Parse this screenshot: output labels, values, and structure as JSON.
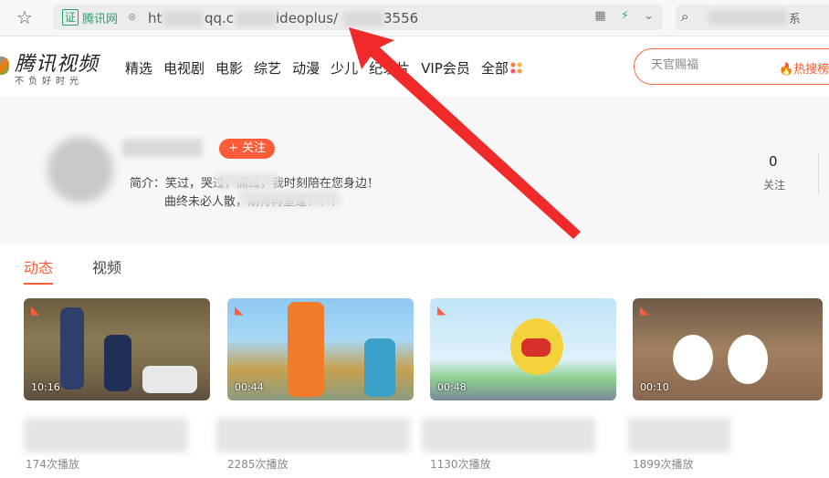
{
  "browser": {
    "cert_label": "证",
    "site_label": "腾讯网",
    "url_parts": {
      "prefix": "ht",
      "domain": "qq.c",
      "path": "ideoplus/",
      "tail": "3556"
    },
    "search_tail": "系"
  },
  "site": {
    "logo_name": "腾讯视频",
    "logo_slogan": "不负好时光",
    "nav": [
      "精选",
      "电视剧",
      "电影",
      "综艺",
      "动漫",
      "少儿",
      "纪录片",
      "VIP会员",
      "全部"
    ],
    "search_placeholder": "天官赐福",
    "hot_label": "热搜榜"
  },
  "profile": {
    "follow_label": "+ 关注",
    "bio_line1": "简介：笑过，哭过，痛过，我时刻陪在您身边！",
    "bio_line2": "曲终未必人散，期待再重逢！！！",
    "stat_value": "0",
    "stat_label": "关注"
  },
  "tabs": [
    "动态",
    "视频"
  ],
  "videos": [
    {
      "duration": "10:16",
      "plays": "174次播放"
    },
    {
      "duration": "00:44",
      "plays": "2285次播放"
    },
    {
      "duration": "00:48",
      "plays": "1130次播放"
    },
    {
      "duration": "00:10",
      "plays": "1899次播放"
    }
  ],
  "colors": {
    "accent": "#ff5d3a",
    "cert_green": "#2aa36b",
    "arrow_red": "#f02a2a"
  }
}
